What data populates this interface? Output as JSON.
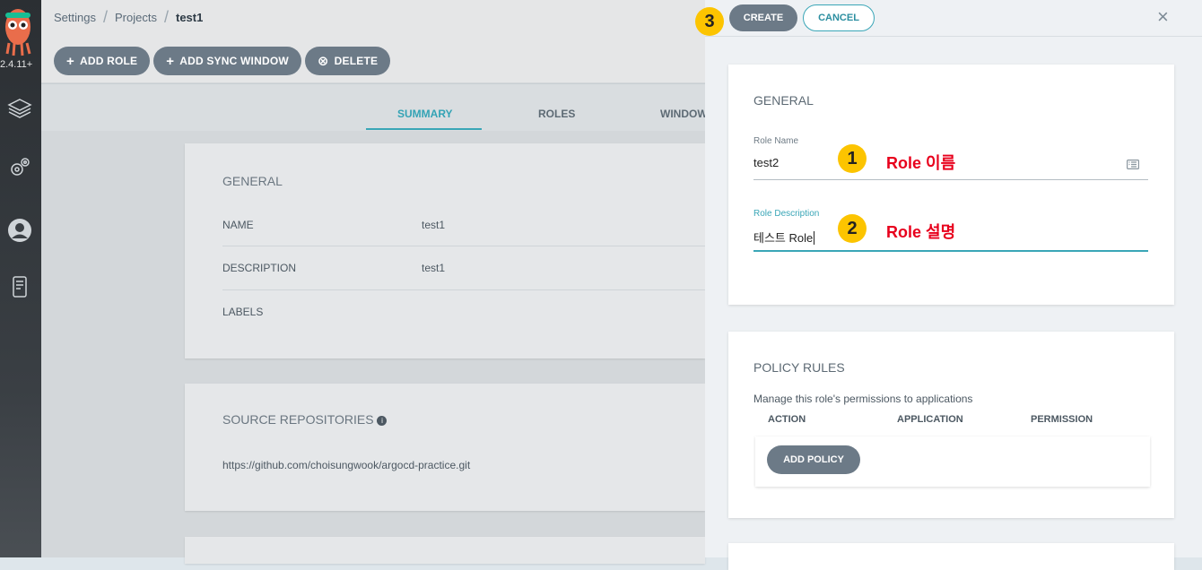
{
  "nav": {
    "version": "2.4.11+"
  },
  "breadcrumb": {
    "items": [
      "Settings",
      "Projects",
      "test1"
    ]
  },
  "toolbar": {
    "add_role": "ADD ROLE",
    "add_sync_window": "ADD SYNC WINDOW",
    "delete": "DELETE"
  },
  "tabs": {
    "summary": "SUMMARY",
    "roles": "ROLES",
    "windows": "WINDOW"
  },
  "general": {
    "title": "GENERAL",
    "name_label": "NAME",
    "name_value": "test1",
    "description_label": "DESCRIPTION",
    "description_value": "test1",
    "labels_label": "LABELS"
  },
  "source": {
    "title": "SOURCE REPOSITORIES",
    "repo": "https://github.com/choisungwook/argocd-practice.git"
  },
  "panel": {
    "create": "CREATE",
    "cancel": "CANCEL",
    "close": "×",
    "general_title": "GENERAL",
    "role_name_label": "Role Name",
    "role_name_value": "test2",
    "role_desc_label": "Role Description",
    "role_desc_value": "테스트 Role",
    "policy_title": "POLICY RULES",
    "policy_desc": "Manage this role's permissions to applications",
    "col_action": "ACTION",
    "col_application": "APPLICATION",
    "col_permission": "PERMISSION",
    "add_policy": "ADD POLICY"
  },
  "annotations": {
    "badge1": "1",
    "badge2": "2",
    "badge3": "3",
    "text1": "Role 이름",
    "text2": "Role 설명"
  },
  "colors": {
    "accent": "#3aa6b7",
    "button": "#6c7a87",
    "badge": "#fcc400",
    "annotation_text": "#e8001c"
  }
}
